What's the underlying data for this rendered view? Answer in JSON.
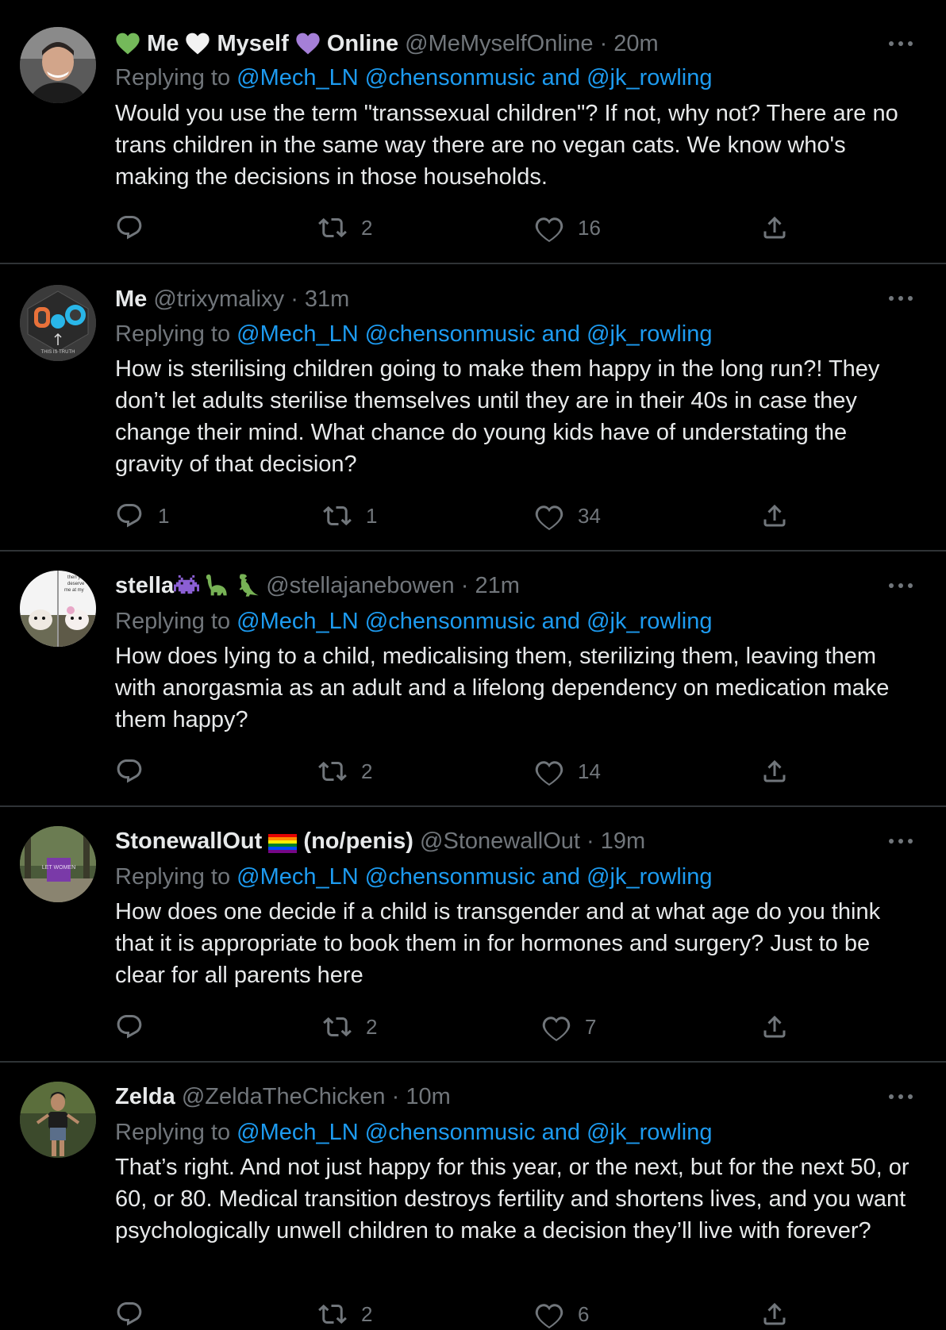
{
  "colors": {
    "background": "#000000",
    "text": "#e7e9ea",
    "muted": "#71767b",
    "link": "#1d9bf0",
    "divider": "#2f3336"
  },
  "replying_prefix": "Replying to ",
  "replying_users": "@Mech_LN @chensonmusic",
  "replying_and": " and ",
  "replying_last": "@jk_rowling",
  "separator": " · ",
  "tweets": [
    {
      "name_parts": [
        "Me",
        "Myself",
        "Online"
      ],
      "name_emojis": [
        "green-heart",
        "white-heart",
        "purple-heart"
      ],
      "handle": "@MeMyselfOnline",
      "time": "20m",
      "text": "Would you use the term \"transsexual children\"? If not, why not? There are no trans children in the same way there are no vegan cats. We know who's making the decisions in those households.",
      "replies": "",
      "retweets": "2",
      "likes": "16"
    },
    {
      "name": "Me",
      "handle": "@trixymalixy",
      "time": "31m",
      "avatar_text": [
        "THIS IS TRUTH"
      ],
      "text": "How is sterilising children going to make them happy in the long run?! They don’t let adults sterilise themselves until they are in their 40s in case they change their mind. What chance do young kids have of understating the gravity of that decision?",
      "replies": "1",
      "retweets": "1",
      "likes": "34"
    },
    {
      "name": "stella",
      "name_emojis": [
        "alien-monster",
        "sauropod",
        "t-rex"
      ],
      "handle": "@stellajanebowen",
      "time": "21m",
      "avatar_text": [
        "then you",
        "deserve",
        "me at my"
      ],
      "text": "How does lying to a child, medicalising them, sterilizing them, leaving them with anorgasmia as an adult and a lifelong dependency on medication make them happy?",
      "replies": "",
      "retweets": "2",
      "likes": "14"
    },
    {
      "name": "StonewallOut",
      "name_suffix": "(no/penis)",
      "name_emojis": [
        "rainbow-flag"
      ],
      "handle": "@StonewallOut",
      "time": "19m",
      "avatar_text": [
        "LET WOMEN"
      ],
      "text": "How does one decide if a child is transgender and at what age do you think that it is appropriate to book them in for hormones and surgery? Just to be clear for all parents here",
      "replies": "",
      "retweets": "2",
      "likes": "7"
    },
    {
      "name": "Zelda",
      "handle": "@ZeldaTheChicken",
      "time": "10m",
      "text": "That’s right. And not just happy for this year, or the next, but for the next 50, or 60, or 80. Medical transition destroys fertility and shortens lives, and you want psychologically unwell children to make a decision they’ll live with forever?",
      "replies": "",
      "retweets": "2",
      "likes": "6"
    }
  ]
}
